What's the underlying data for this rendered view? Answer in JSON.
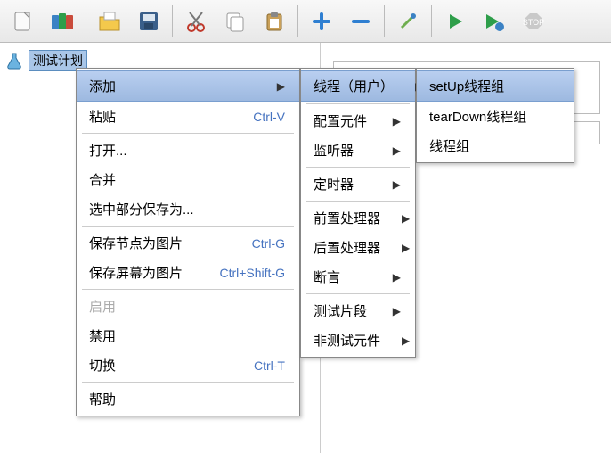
{
  "toolbar": {
    "icons": [
      "paper-icon",
      "books-icon",
      "open-icon",
      "save-icon",
      "cut-icon",
      "copy-icon",
      "paste-icon",
      "plus-icon",
      "minus-icon",
      "wand-icon",
      "play-icon",
      "play-next-icon",
      "stop-icon"
    ]
  },
  "tree": {
    "root_label": "测试计划"
  },
  "menu1": {
    "add": "添加",
    "paste": "粘贴",
    "paste_sc": "Ctrl-V",
    "open": "打开...",
    "merge": "合并",
    "save_sel": "选中部分保存为...",
    "save_node_img": "保存节点为图片",
    "save_node_img_sc": "Ctrl-G",
    "save_screen_img": "保存屏幕为图片",
    "save_screen_img_sc": "Ctrl+Shift-G",
    "enable": "启用",
    "disable": "禁用",
    "toggle": "切换",
    "toggle_sc": "Ctrl-T",
    "help": "帮助"
  },
  "menu2": {
    "threads": "线程（用户）",
    "config": "配置元件",
    "listener": "监听器",
    "timer": "定时器",
    "preproc": "前置处理器",
    "postproc": "后置处理器",
    "assert": "断言",
    "frag": "测试片段",
    "nontest": "非测试元件"
  },
  "menu3": {
    "setup": "setUp线程组",
    "teardown": "tearDown线程组",
    "tg": "线程组"
  }
}
